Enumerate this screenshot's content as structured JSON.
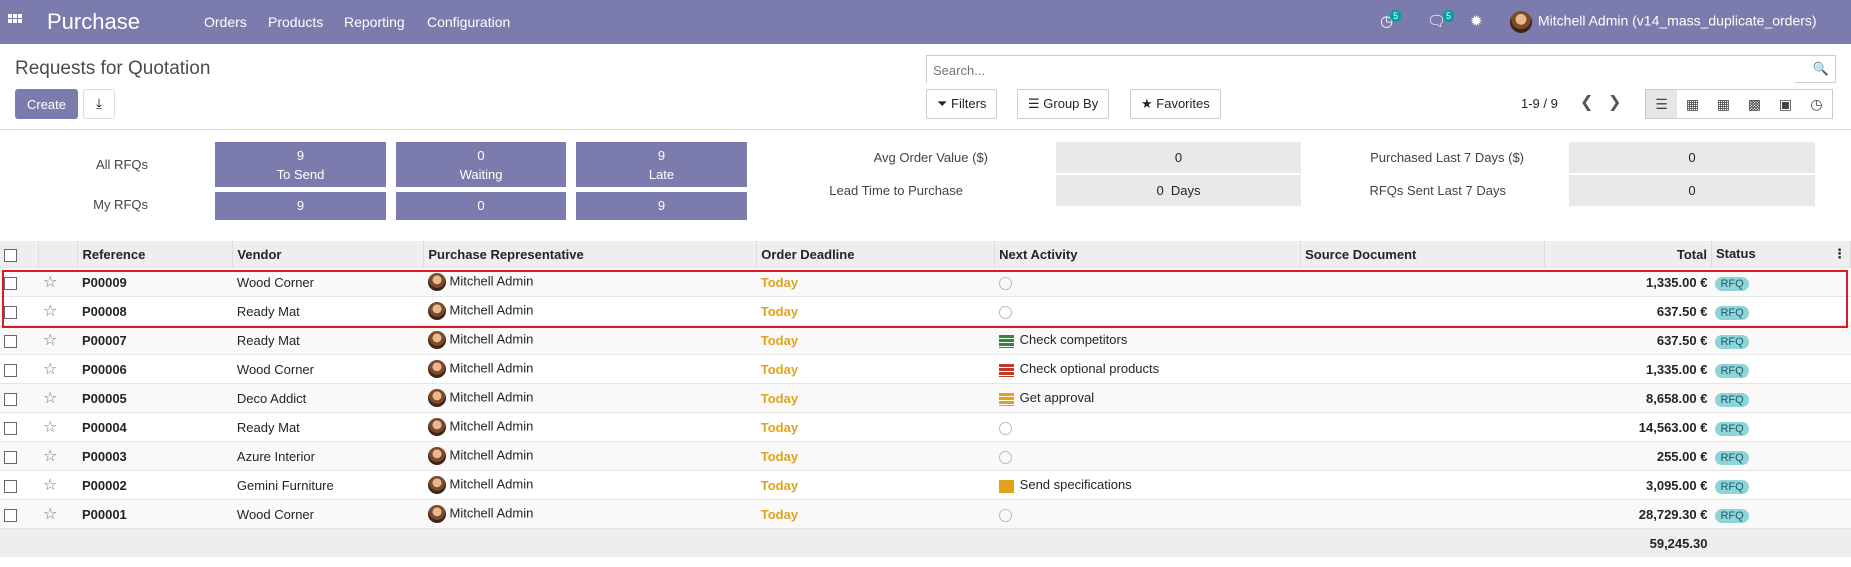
{
  "topbar": {
    "app_title": "Purchase",
    "menu": [
      "Orders",
      "Products",
      "Reporting",
      "Configuration"
    ],
    "activity_count": "5",
    "message_count": "5",
    "user": "Mitchell Admin (v14_mass_duplicate_orders)"
  },
  "control_panel": {
    "title": "Requests for Quotation",
    "create_label": "Create",
    "search_placeholder": "Search...",
    "filters_label": "Filters",
    "groupby_label": "Group By",
    "favorites_label": "Favorites",
    "pager": "1-9 / 9"
  },
  "dashboard": {
    "all_rfqs": "All RFQs",
    "my_rfqs": "My RFQs",
    "tiles": [
      {
        "count": "9",
        "label": "To Send",
        "my": "9"
      },
      {
        "count": "0",
        "label": "Waiting",
        "my": "0"
      },
      {
        "count": "9",
        "label": "Late",
        "my": "9"
      }
    ],
    "avg_order_label": "Avg Order Value ($)",
    "avg_order_value": "0",
    "lead_time_label": "Lead Time to Purchase",
    "lead_time_value": "0  Days",
    "purchased_label": "Purchased Last 7 Days ($)",
    "purchased_value": "0",
    "rfqs_sent_label": "RFQs Sent Last 7 Days",
    "rfqs_sent_value": "0"
  },
  "table": {
    "headers": [
      "Reference",
      "Vendor",
      "Purchase Representative",
      "Order Deadline",
      "Next Activity",
      "Source Document",
      "Total",
      "Status"
    ],
    "rows": [
      {
        "ref": "P00009",
        "vendor": "Wood Corner",
        "rep": "Mitchell Admin",
        "deadline": "Today",
        "activity": "",
        "activity_icon": "clock-icon",
        "total": "1,335.00 €",
        "status": "RFQ"
      },
      {
        "ref": "P00008",
        "vendor": "Ready Mat",
        "rep": "Mitchell Admin",
        "deadline": "Today",
        "activity": "",
        "activity_icon": "clock-icon",
        "total": "637.50 €",
        "status": "RFQ"
      },
      {
        "ref": "P00007",
        "vendor": "Ready Mat",
        "rep": "Mitchell Admin",
        "deadline": "Today",
        "activity": "Check competitors",
        "activity_icon": "tasks-green-icon",
        "total": "637.50 €",
        "status": "RFQ"
      },
      {
        "ref": "P00006",
        "vendor": "Wood Corner",
        "rep": "Mitchell Admin",
        "deadline": "Today",
        "activity": "Check optional products",
        "activity_icon": "tasks-red-icon",
        "total": "1,335.00 €",
        "status": "RFQ"
      },
      {
        "ref": "P00005",
        "vendor": "Deco Addict",
        "rep": "Mitchell Admin",
        "deadline": "Today",
        "activity": "Get approval",
        "activity_icon": "tasks-yellow-icon",
        "total": "8,658.00 €",
        "status": "RFQ"
      },
      {
        "ref": "P00004",
        "vendor": "Ready Mat",
        "rep": "Mitchell Admin",
        "deadline": "Today",
        "activity": "",
        "activity_icon": "clock-icon",
        "total": "14,563.00 €",
        "status": "RFQ"
      },
      {
        "ref": "P00003",
        "vendor": "Azure Interior",
        "rep": "Mitchell Admin",
        "deadline": "Today",
        "activity": "",
        "activity_icon": "clock-icon",
        "total": "255.00 €",
        "status": "RFQ"
      },
      {
        "ref": "P00002",
        "vendor": "Gemini Furniture",
        "rep": "Mitchell Admin",
        "deadline": "Today",
        "activity": "Send specifications",
        "activity_icon": "envelope-icon",
        "total": "3,095.00 €",
        "status": "RFQ"
      },
      {
        "ref": "P00001",
        "vendor": "Wood Corner",
        "rep": "Mitchell Admin",
        "deadline": "Today",
        "activity": "",
        "activity_icon": "clock-icon",
        "total": "28,729.30 €",
        "status": "RFQ"
      }
    ],
    "grand_total": "59,245.30"
  },
  "colors": {
    "brand": "#7c7bad",
    "deadline": "#e3a21a",
    "status_badge": "#8fd5d8",
    "highlight": "#e0181f"
  }
}
